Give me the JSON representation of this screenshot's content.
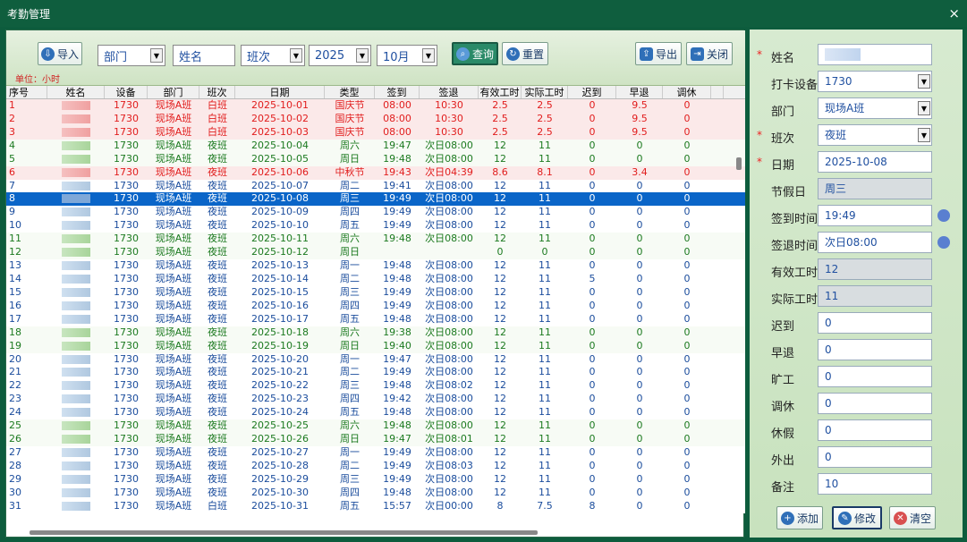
{
  "window": {
    "title": "考勤管理",
    "close_icon": "×"
  },
  "toolbar": {
    "import_label": "导入",
    "dept_value": "部门",
    "name_placeholder": "姓名",
    "shift_value": "班次",
    "year_value": "2025",
    "month_value": "10月",
    "query_label": "查询",
    "reset_label": "重置",
    "export_label": "导出",
    "close_label": "关闭",
    "unit_text": "单位：小时"
  },
  "grid": {
    "headers": [
      "序号",
      "姓名",
      "设备",
      "部门",
      "班次",
      "日期",
      "类型",
      "签到",
      "签退",
      "有效工时",
      "实际工时",
      "迟到",
      "早退",
      "调休"
    ],
    "rows": [
      {
        "style": "red",
        "cells": [
          "1",
          "",
          "1730",
          "现场A班",
          "白班",
          "2025-10-01",
          "国庆节",
          "08:00",
          "10:30",
          "2.5",
          "2.5",
          "0",
          "9.5",
          "0"
        ]
      },
      {
        "style": "red",
        "cells": [
          "2",
          "",
          "1730",
          "现场A班",
          "白班",
          "2025-10-02",
          "国庆节",
          "08:00",
          "10:30",
          "2.5",
          "2.5",
          "0",
          "9.5",
          "0"
        ]
      },
      {
        "style": "red",
        "cells": [
          "3",
          "",
          "1730",
          "现场A班",
          "白班",
          "2025-10-03",
          "国庆节",
          "08:00",
          "10:30",
          "2.5",
          "2.5",
          "0",
          "9.5",
          "0"
        ]
      },
      {
        "style": "green",
        "cells": [
          "4",
          "",
          "1730",
          "现场A班",
          "夜班",
          "2025-10-04",
          "周六",
          "19:47",
          "次日08:00",
          "12",
          "11",
          "0",
          "0",
          "0"
        ]
      },
      {
        "style": "green",
        "cells": [
          "5",
          "",
          "1730",
          "现场A班",
          "夜班",
          "2025-10-05",
          "周日",
          "19:48",
          "次日08:00",
          "12",
          "11",
          "0",
          "0",
          "0"
        ]
      },
      {
        "style": "red",
        "cells": [
          "6",
          "",
          "1730",
          "现场A班",
          "夜班",
          "2025-10-06",
          "中秋节",
          "19:43",
          "次日04:39",
          "8.6",
          "8.1",
          "0",
          "3.4",
          "0"
        ]
      },
      {
        "style": "blue",
        "cells": [
          "7",
          "",
          "1730",
          "现场A班",
          "夜班",
          "2025-10-07",
          "周二",
          "19:41",
          "次日08:00",
          "12",
          "11",
          "0",
          "0",
          "0"
        ]
      },
      {
        "style": "selected",
        "cells": [
          "8",
          "",
          "1730",
          "现场A班",
          "夜班",
          "2025-10-08",
          "周三",
          "19:49",
          "次日08:00",
          "12",
          "11",
          "0",
          "0",
          "0"
        ]
      },
      {
        "style": "blue",
        "cells": [
          "9",
          "",
          "1730",
          "现场A班",
          "夜班",
          "2025-10-09",
          "周四",
          "19:49",
          "次日08:00",
          "12",
          "11",
          "0",
          "0",
          "0"
        ]
      },
      {
        "style": "blue",
        "cells": [
          "10",
          "",
          "1730",
          "现场A班",
          "夜班",
          "2025-10-10",
          "周五",
          "19:49",
          "次日08:00",
          "12",
          "11",
          "0",
          "0",
          "0"
        ]
      },
      {
        "style": "green",
        "cells": [
          "11",
          "",
          "1730",
          "现场A班",
          "夜班",
          "2025-10-11",
          "周六",
          "19:48",
          "次日08:00",
          "12",
          "11",
          "0",
          "0",
          "0"
        ]
      },
      {
        "style": "green",
        "cells": [
          "12",
          "",
          "1730",
          "现场A班",
          "夜班",
          "2025-10-12",
          "周日",
          "",
          "",
          "0",
          "0",
          "0",
          "0",
          "0"
        ]
      },
      {
        "style": "blue",
        "cells": [
          "13",
          "",
          "1730",
          "现场A班",
          "夜班",
          "2025-10-13",
          "周一",
          "19:48",
          "次日08:00",
          "12",
          "11",
          "0",
          "0",
          "0"
        ]
      },
      {
        "style": "blue",
        "cells": [
          "14",
          "",
          "1730",
          "现场A班",
          "夜班",
          "2025-10-14",
          "周二",
          "19:48",
          "次日08:00",
          "12",
          "11",
          "5",
          "0",
          "0"
        ]
      },
      {
        "style": "blue",
        "cells": [
          "15",
          "",
          "1730",
          "现场A班",
          "夜班",
          "2025-10-15",
          "周三",
          "19:49",
          "次日08:00",
          "12",
          "11",
          "0",
          "0",
          "0"
        ]
      },
      {
        "style": "blue",
        "cells": [
          "16",
          "",
          "1730",
          "现场A班",
          "夜班",
          "2025-10-16",
          "周四",
          "19:49",
          "次日08:00",
          "12",
          "11",
          "0",
          "0",
          "0"
        ]
      },
      {
        "style": "blue",
        "cells": [
          "17",
          "",
          "1730",
          "现场A班",
          "夜班",
          "2025-10-17",
          "周五",
          "19:48",
          "次日08:00",
          "12",
          "11",
          "0",
          "0",
          "0"
        ]
      },
      {
        "style": "green",
        "cells": [
          "18",
          "",
          "1730",
          "现场A班",
          "夜班",
          "2025-10-18",
          "周六",
          "19:38",
          "次日08:00",
          "12",
          "11",
          "0",
          "0",
          "0"
        ]
      },
      {
        "style": "green",
        "cells": [
          "19",
          "",
          "1730",
          "现场A班",
          "夜班",
          "2025-10-19",
          "周日",
          "19:40",
          "次日08:00",
          "12",
          "11",
          "0",
          "0",
          "0"
        ]
      },
      {
        "style": "blue",
        "cells": [
          "20",
          "",
          "1730",
          "现场A班",
          "夜班",
          "2025-10-20",
          "周一",
          "19:47",
          "次日08:00",
          "12",
          "11",
          "0",
          "0",
          "0"
        ]
      },
      {
        "style": "blue",
        "cells": [
          "21",
          "",
          "1730",
          "现场A班",
          "夜班",
          "2025-10-21",
          "周二",
          "19:49",
          "次日08:00",
          "12",
          "11",
          "0",
          "0",
          "0"
        ]
      },
      {
        "style": "blue",
        "cells": [
          "22",
          "",
          "1730",
          "现场A班",
          "夜班",
          "2025-10-22",
          "周三",
          "19:48",
          "次日08:02",
          "12",
          "11",
          "0",
          "0",
          "0"
        ]
      },
      {
        "style": "blue",
        "cells": [
          "23",
          "",
          "1730",
          "现场A班",
          "夜班",
          "2025-10-23",
          "周四",
          "19:42",
          "次日08:00",
          "12",
          "11",
          "0",
          "0",
          "0"
        ]
      },
      {
        "style": "blue",
        "cells": [
          "24",
          "",
          "1730",
          "现场A班",
          "夜班",
          "2025-10-24",
          "周五",
          "19:48",
          "次日08:00",
          "12",
          "11",
          "0",
          "0",
          "0"
        ]
      },
      {
        "style": "green",
        "cells": [
          "25",
          "",
          "1730",
          "现场A班",
          "夜班",
          "2025-10-25",
          "周六",
          "19:48",
          "次日08:00",
          "12",
          "11",
          "0",
          "0",
          "0"
        ]
      },
      {
        "style": "green",
        "cells": [
          "26",
          "",
          "1730",
          "现场A班",
          "夜班",
          "2025-10-26",
          "周日",
          "19:47",
          "次日08:01",
          "12",
          "11",
          "0",
          "0",
          "0"
        ]
      },
      {
        "style": "blue",
        "cells": [
          "27",
          "",
          "1730",
          "现场A班",
          "夜班",
          "2025-10-27",
          "周一",
          "19:49",
          "次日08:00",
          "12",
          "11",
          "0",
          "0",
          "0"
        ]
      },
      {
        "style": "blue",
        "cells": [
          "28",
          "",
          "1730",
          "现场A班",
          "夜班",
          "2025-10-28",
          "周二",
          "19:49",
          "次日08:03",
          "12",
          "11",
          "0",
          "0",
          "0"
        ]
      },
      {
        "style": "blue",
        "cells": [
          "29",
          "",
          "1730",
          "现场A班",
          "夜班",
          "2025-10-29",
          "周三",
          "19:49",
          "次日08:00",
          "12",
          "11",
          "0",
          "0",
          "0"
        ]
      },
      {
        "style": "blue",
        "cells": [
          "30",
          "",
          "1730",
          "现场A班",
          "夜班",
          "2025-10-30",
          "周四",
          "19:48",
          "次日08:00",
          "12",
          "11",
          "0",
          "0",
          "0"
        ]
      },
      {
        "style": "blue",
        "cells": [
          "31",
          "",
          "1730",
          "现场A班",
          "白班",
          "2025-10-31",
          "周五",
          "15:57",
          "次日00:00",
          "8",
          "7.5",
          "8",
          "0",
          "0"
        ]
      }
    ]
  },
  "form": {
    "fields": [
      {
        "label": "姓名",
        "value": "",
        "required": true,
        "type": "text"
      },
      {
        "label": "打卡设备",
        "value": "1730",
        "required": false,
        "type": "select"
      },
      {
        "label": "部门",
        "value": "现场A班",
        "required": false,
        "type": "select"
      },
      {
        "label": "班次",
        "value": "夜班",
        "required": true,
        "type": "select"
      },
      {
        "label": "日期",
        "value": "2025-10-08",
        "required": true,
        "type": "text"
      },
      {
        "label": "节假日",
        "value": "周三",
        "required": false,
        "type": "readonly"
      },
      {
        "label": "签到时间",
        "value": "19:49",
        "required": false,
        "type": "time"
      },
      {
        "label": "签退时间",
        "value": "次日08:00",
        "required": false,
        "type": "time"
      },
      {
        "label": "有效工时",
        "value": "12",
        "required": false,
        "type": "readonly"
      },
      {
        "label": "实际工时",
        "value": "11",
        "required": false,
        "type": "readonly"
      },
      {
        "label": "迟到",
        "value": "0",
        "required": false,
        "type": "text"
      },
      {
        "label": "早退",
        "value": "0",
        "required": false,
        "type": "text"
      },
      {
        "label": "旷工",
        "value": "0",
        "required": false,
        "type": "text"
      },
      {
        "label": "调休",
        "value": "0",
        "required": false,
        "type": "text"
      },
      {
        "label": "休假",
        "value": "0",
        "required": false,
        "type": "text"
      },
      {
        "label": "外出",
        "value": "0",
        "required": false,
        "type": "text"
      },
      {
        "label": "备注",
        "value": "10",
        "required": false,
        "type": "text"
      }
    ],
    "add_label": "添加",
    "edit_label": "修改",
    "clear_label": "清空"
  }
}
